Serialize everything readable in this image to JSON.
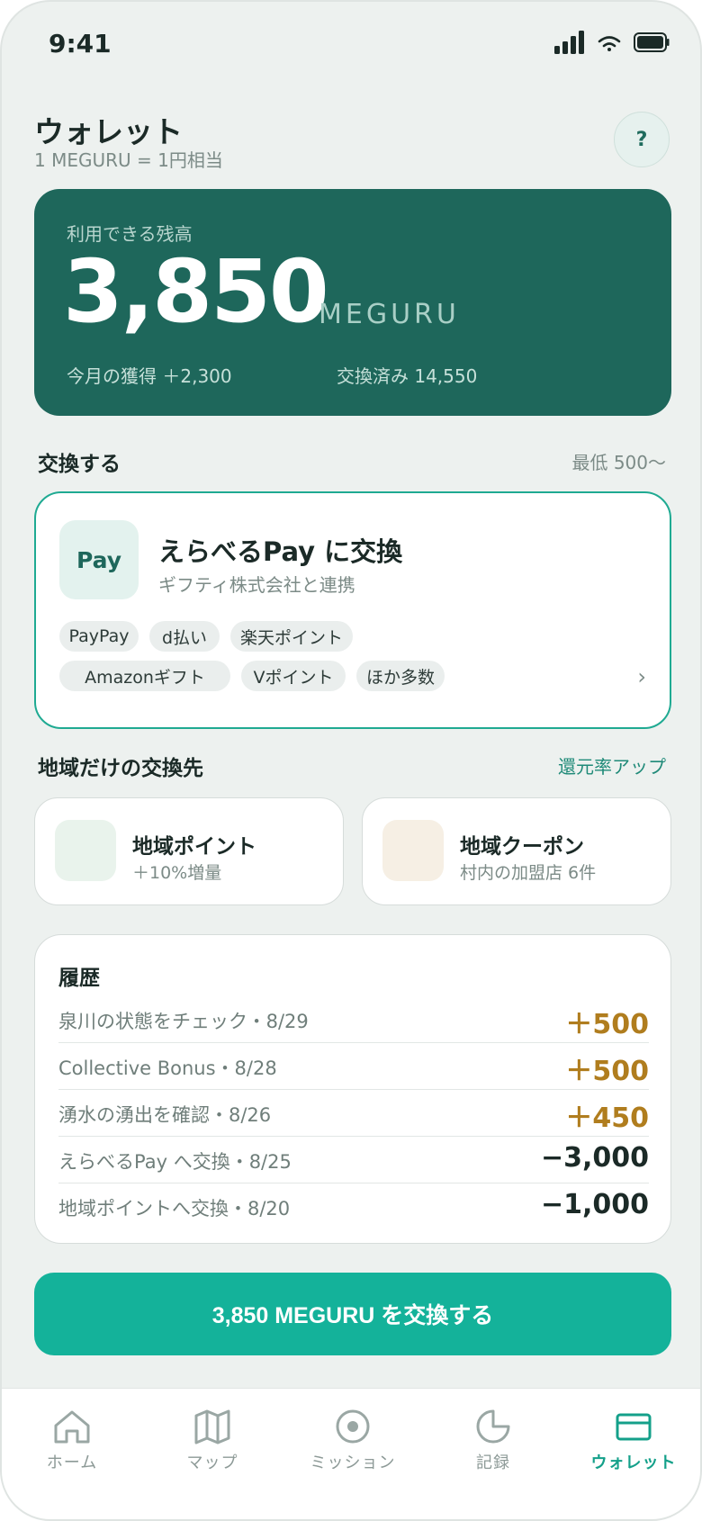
{
  "status": {
    "time": "9:41"
  },
  "header": {
    "title": "ウォレット",
    "rate_note": "1 MEGURU = 1円相当",
    "help_label": "?"
  },
  "balance": {
    "label": "利用できる残高",
    "amount": "3,850",
    "unit": "MEGURU",
    "earned": "今月の獲得 ＋2,300",
    "exchanged": "交換済み 14,550"
  },
  "exchange_section": {
    "title": "交換する",
    "note": "最低 500〜"
  },
  "pay_card": {
    "logo": "Pay",
    "title": "えらべるPay に交換",
    "subtitle": "ギフティ株式会社と連携",
    "chips": [
      "PayPay",
      "d払い",
      "楽天ポイント",
      "Amazonギフト",
      "Vポイント",
      "ほか多数"
    ],
    "chevron": "›"
  },
  "local_section": {
    "title": "地域だけの交換先",
    "note": "還元率アップ",
    "cards": [
      {
        "title": "地域ポイント",
        "sub": "＋10%増量"
      },
      {
        "title": "地域クーポン",
        "sub": "村内の加盟店 6件"
      }
    ]
  },
  "history": {
    "title": "履歴",
    "rows": [
      {
        "label": "泉川の状態をチェック・8/29",
        "amount": "＋500",
        "kind": "gain"
      },
      {
        "label": "Collective Bonus・8/28",
        "amount": "＋500",
        "kind": "gain"
      },
      {
        "label": "湧水の湧出を確認・8/26",
        "amount": "＋450",
        "kind": "gain"
      },
      {
        "label": "えらべるPay へ交換・8/25",
        "amount": "−3,000",
        "kind": "spend"
      },
      {
        "label": "地域ポイントへ交換・8/20",
        "amount": "−1,000",
        "kind": "spend"
      }
    ]
  },
  "cta": {
    "label": "3,850 MEGURU を交換する"
  },
  "tabs": [
    {
      "label": "ホーム",
      "icon": "home-icon"
    },
    {
      "label": "マップ",
      "icon": "map-icon"
    },
    {
      "label": "ミッション",
      "icon": "target-icon"
    },
    {
      "label": "記録",
      "icon": "pie-chart-icon"
    },
    {
      "label": "ウォレット",
      "icon": "wallet-icon",
      "active": true
    }
  ],
  "colors": {
    "brand_dark": "#1e675b",
    "accent": "#14b29a",
    "gain": "#b07d1e",
    "spend": "#1b2a27",
    "background": "#edf1ef"
  }
}
